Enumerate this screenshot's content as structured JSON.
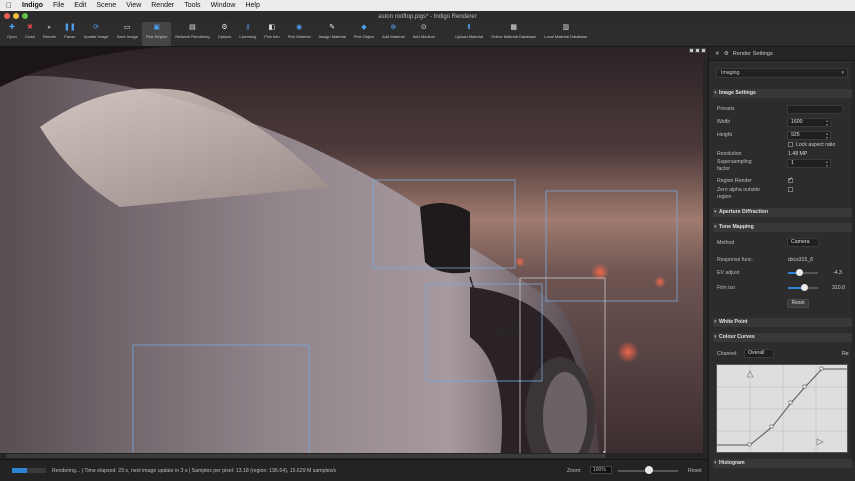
{
  "menubar": {
    "app_name": "Indigo",
    "items": [
      "File",
      "Edit",
      "Scene",
      "View",
      "Render",
      "Tools",
      "Window",
      "Help"
    ]
  },
  "window": {
    "title": "aston rooftop.pigs* - Indigo Renderer"
  },
  "toolbar": {
    "tools": [
      {
        "label": "Open",
        "icon": "open-plus-icon"
      },
      {
        "label": "Close",
        "icon": "close-x-icon"
      },
      {
        "label": "Render",
        "icon": "render-play-icon"
      },
      {
        "label": "Pause",
        "icon": "pause-icon"
      },
      {
        "label": "Update Image",
        "icon": "refresh-icon"
      },
      {
        "label": "Save Image",
        "icon": "save-image-icon"
      },
      {
        "label": "Pick Region",
        "icon": "pick-region-icon"
      },
      {
        "label": "Network Rendering",
        "icon": "network-icon"
      },
      {
        "label": "Options",
        "icon": "options-gear-icon"
      },
      {
        "label": "Licensing",
        "icon": "key-icon"
      },
      {
        "label": "Pick Info",
        "icon": "pick-info-icon"
      },
      {
        "label": "Pick Material",
        "icon": "pick-material-icon"
      },
      {
        "label": "Assign Material",
        "icon": "assign-material-icon"
      },
      {
        "label": "Pick Object",
        "icon": "pick-object-icon"
      },
      {
        "label": "Add Material",
        "icon": "add-material-icon"
      },
      {
        "label": "Add Medium",
        "icon": "add-medium-icon"
      },
      {
        "label": "Upload Material",
        "icon": "upload-icon"
      },
      {
        "label": "Online Material Database",
        "icon": "online-db-icon"
      },
      {
        "label": "Local Material Database",
        "icon": "local-db-icon"
      }
    ]
  },
  "status": {
    "progress": 0.45,
    "text": "Rendering... | Time elapsed: 23 s, next image update in 3 s | Samples per pixel: 13.18 (region: 195.64), 15.629 M samples/s",
    "zoom_label": "Zoom:",
    "zoom_value": "100%",
    "reset_label": "Reset"
  },
  "panel": {
    "title": "Render Settings",
    "mode": "Imaging",
    "image_settings": {
      "title": "Image Settings",
      "presets_label": "Presets",
      "width_label": "Width",
      "width_value": "1600",
      "height_label": "Height",
      "height_value": "925",
      "lock_aspect_label": "Lock aspect ratio",
      "lock_aspect_checked": false,
      "resolution_label": "Resolution",
      "resolution_value": "1.48 MP",
      "supersampling_label_1": "Supersampling",
      "supersampling_label_2": "factor",
      "supersampling_value": "1",
      "region_render_label": "Region Render",
      "region_render_checked": true,
      "zero_alpha_label_1": "Zero alpha outside",
      "zero_alpha_label_2": "region",
      "zero_alpha_checked": false
    },
    "aperture_diffraction": "Aperture Diffraction",
    "tone_mapping": {
      "title": "Tone Mapping",
      "method_label": "Method",
      "method_value": "Camera",
      "response_label": "Response func.",
      "response_value": "dscs315_6",
      "ev_label": "EV adjust",
      "ev_value": "-4.3",
      "film_iso_label": "Film iso",
      "film_iso_value": "310.0",
      "reset_label": "Reset"
    },
    "white_point": "White Point",
    "colour_curves": {
      "title": "Colour Curves",
      "channel_label": "Channel:",
      "channel_value": "Overall",
      "reset_short": "Re"
    },
    "histogram": "Histogram"
  },
  "colors": {
    "accent": "#2d83d6",
    "region_outline": "#7aa9d8"
  }
}
